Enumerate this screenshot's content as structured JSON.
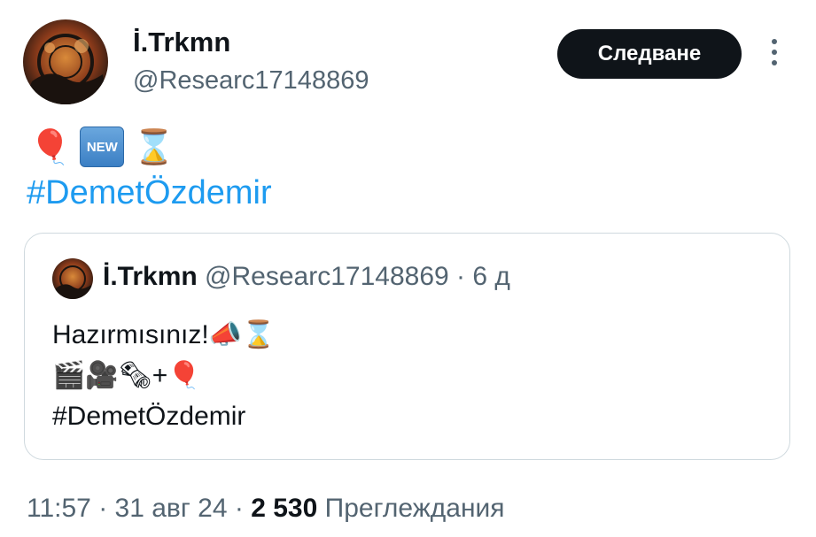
{
  "author": {
    "display_name": "İ.Trkmn",
    "handle": "@Researc17148869",
    "avatar_icon": "profile-photo"
  },
  "follow_label": "Следване",
  "more_icon": "three-dots-vertical",
  "tweet": {
    "emojis": [
      "🎈",
      "NEW",
      "⌛"
    ],
    "hashtag": "#DemetÖzdemir"
  },
  "quoted": {
    "display_name": "İ.Trkmn",
    "handle": "@Researc17148869",
    "separator": "·",
    "time_ago": "6 д",
    "lines": [
      "Hazırmısınız!📣⌛",
      "🎬🎥🗞+🎈",
      "#DemetÖzdemir"
    ]
  },
  "meta": {
    "time": "11:57",
    "sep1": "·",
    "date": "31 авг 24",
    "sep2": "·",
    "views_count": "2 530",
    "views_label": "Преглеждания"
  },
  "colors": {
    "link": "#1d9bf0",
    "muted": "#536471",
    "text": "#0f1419",
    "border": "#cfd9de"
  }
}
